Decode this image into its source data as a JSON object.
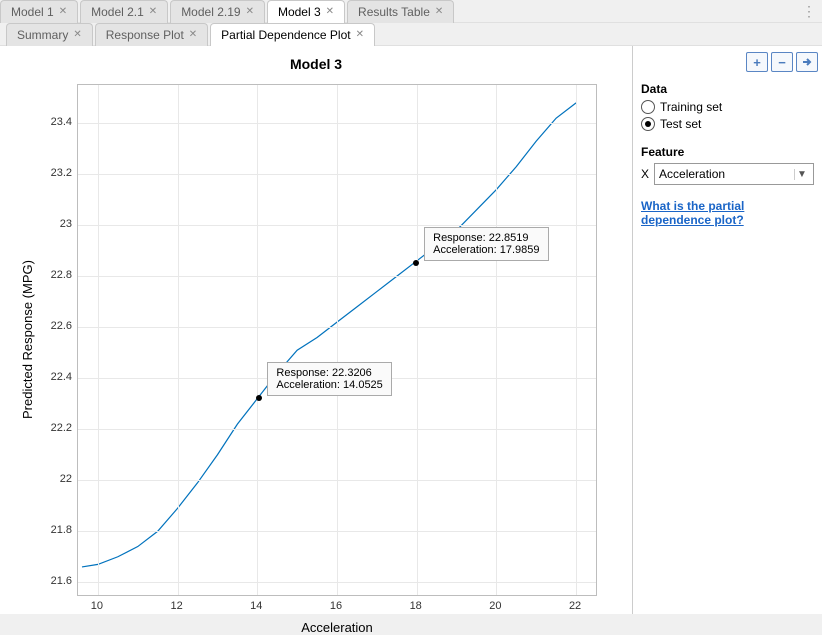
{
  "tabs_top": [
    {
      "label": "Model 1",
      "active": false
    },
    {
      "label": "Model 2.1",
      "active": false
    },
    {
      "label": "Model 2.19",
      "active": false
    },
    {
      "label": "Model 3",
      "active": true
    },
    {
      "label": "Results Table",
      "active": false
    }
  ],
  "tabs_sub": [
    {
      "label": "Summary",
      "active": false
    },
    {
      "label": "Response Plot",
      "active": false
    },
    {
      "label": "Partial Dependence Plot",
      "active": true
    }
  ],
  "chart_title": "Model 3",
  "xlabel": "Acceleration",
  "ylabel": "Predicted Response (MPG)",
  "side": {
    "data_header": "Data",
    "radio_train": "Training set",
    "radio_test": "Test set",
    "selected_radio": "test",
    "feature_header": "Feature",
    "feature_prefix": "X",
    "feature_value": "Acceleration",
    "help_link": "What is the partial dependence plot?"
  },
  "datatips": [
    {
      "response_label": "Response",
      "accel_label": "Acceleration",
      "response": 22.3206,
      "accel": 14.0525
    },
    {
      "response_label": "Response",
      "accel_label": "Acceleration",
      "response": 22.8519,
      "accel": 17.9859
    }
  ],
  "chart_data": {
    "type": "line",
    "xlabel": "Acceleration",
    "ylabel": "Predicted Response (MPG)",
    "title": "Model 3",
    "xlim": [
      9.5,
      22.5
    ],
    "ylim": [
      21.55,
      23.55
    ],
    "xticks": [
      10,
      12,
      14,
      16,
      18,
      20,
      22
    ],
    "yticks": [
      21.6,
      21.8,
      22.0,
      22.2,
      22.4,
      22.6,
      22.8,
      23.0,
      23.2,
      23.4
    ],
    "series": [
      {
        "name": "Partial Dependence",
        "color": "#0072bd",
        "x": [
          9.6,
          10.0,
          10.5,
          11.0,
          11.5,
          12.0,
          12.5,
          13.0,
          13.5,
          14.0,
          14.5,
          15.0,
          15.5,
          16.0,
          16.5,
          17.0,
          17.5,
          18.0,
          18.5,
          19.0,
          19.5,
          20.0,
          20.5,
          21.0,
          21.5,
          22.0
        ],
        "y": [
          21.66,
          21.67,
          21.7,
          21.74,
          21.8,
          21.89,
          21.99,
          22.1,
          22.22,
          22.32,
          22.42,
          22.51,
          22.56,
          22.62,
          22.68,
          22.74,
          22.8,
          22.86,
          22.92,
          22.98,
          23.06,
          23.14,
          23.23,
          23.33,
          23.42,
          23.48
        ]
      }
    ]
  }
}
